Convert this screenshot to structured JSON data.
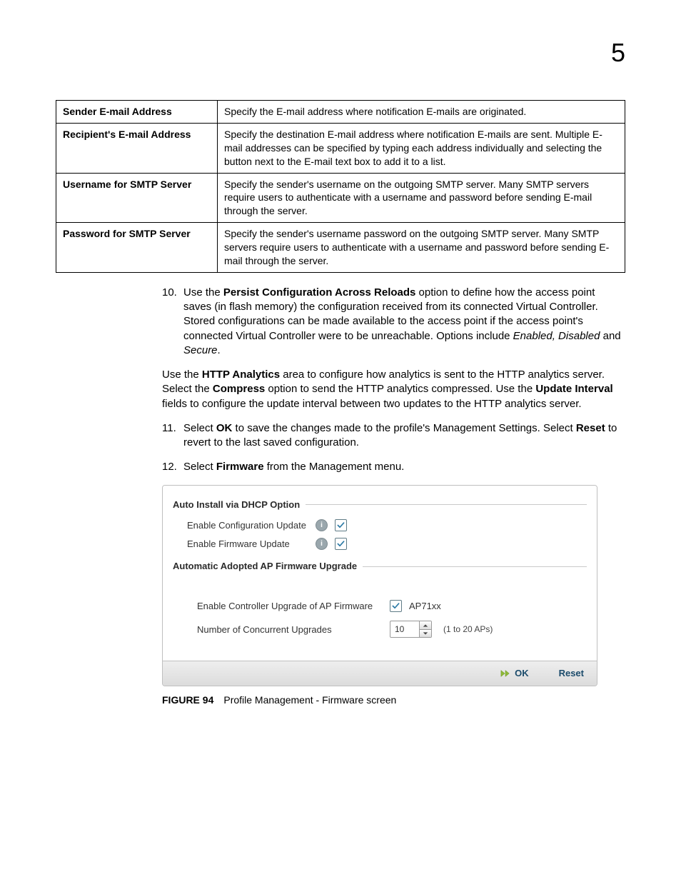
{
  "chapter_number": "5",
  "table": {
    "rows": [
      {
        "label": "Sender E-mail Address",
        "desc": "Specify the E-mail address where notification E-mails are originated."
      },
      {
        "label": "Recipient's E-mail Address",
        "desc": "Specify the destination E-mail address where notification E-mails are sent. Multiple E-mail addresses can be specified by typing each address individually and selecting the button next to the E-mail text box to add it to a list."
      },
      {
        "label": "Username for SMTP Server",
        "desc": "Specify the sender's username on the outgoing SMTP server. Many SMTP servers require users to authenticate with a username and password before sending E-mail through the server."
      },
      {
        "label": "Password for SMTP Server",
        "desc": "Specify the sender's username password on the outgoing SMTP server. Many SMTP servers require users to authenticate with a username and password before sending E-mail through the server."
      }
    ]
  },
  "body": {
    "step10_num": "10.",
    "step10_prefix": "Use the ",
    "step10_bold": "Persist Configuration Across Reloads",
    "step10_rest": " option to define how the access point saves (in flash memory) the configuration received from its connected Virtual Controller. Stored configurations can be made available to the access point if the access point's connected Virtual Controller were to be unreachable. Options include ",
    "step10_italic1": "Enabled, Disabled",
    "step10_and": " and ",
    "step10_italic2": "Secure",
    "step10_period": ".",
    "http_p_prefix": "Use the ",
    "http_bold1": "HTTP Analytics",
    "http_mid1": " area to configure how analytics is sent to the HTTP analytics server. Select the ",
    "http_bold2": "Compress",
    "http_mid2": " option to send the HTTP analytics compressed. Use the ",
    "http_bold3": "Update Interval",
    "http_rest": " fields to configure the update interval between two updates to the HTTP analytics server.",
    "step11_num": "11.",
    "step11_prefix": "Select ",
    "step11_bold1": "OK",
    "step11_mid": " to save the changes made to the profile's Management Settings. Select ",
    "step11_bold2": "Reset",
    "step11_rest": " to revert to the last saved configuration.",
    "step12_num": "12.",
    "step12_prefix": "Select ",
    "step12_bold": "Firmware",
    "step12_rest": " from the Management menu."
  },
  "figure": {
    "fieldset1_title": "Auto Install via DHCP Option",
    "row_enable_config": "Enable Configuration Update",
    "row_enable_firmware": "Enable Firmware Update",
    "fieldset2_title": "Automatic Adopted AP Firmware Upgrade",
    "row_ctrl_upgrade": "Enable Controller Upgrade of AP Firmware",
    "ctrl_upgrade_model": "AP71xx",
    "row_concurrent": "Number of Concurrent Upgrades",
    "concurrent_value": "10",
    "concurrent_hint": "(1 to 20 APs)",
    "btn_ok": "OK",
    "btn_reset": "Reset"
  },
  "caption": {
    "label": "FIGURE 94",
    "text": "Profile Management - Firmware screen"
  }
}
